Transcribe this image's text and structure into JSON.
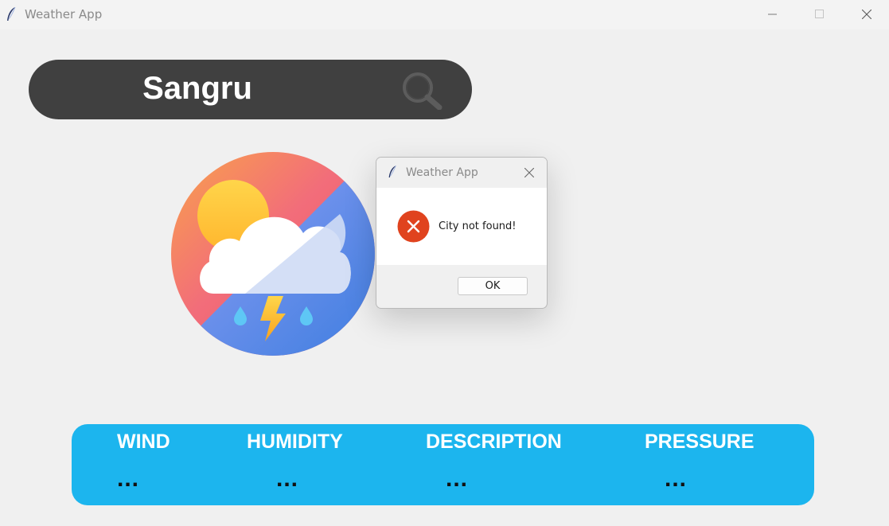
{
  "window": {
    "title": "Weather App",
    "controls": [
      "minimize-icon",
      "maximize-icon",
      "close-icon"
    ]
  },
  "search": {
    "value": "Sangru",
    "icon": "search-icon"
  },
  "weather_icon": "thunderstorm-icon",
  "dialog": {
    "title": "Weather App",
    "message": "City not found!",
    "icon": "error-icon",
    "ok_label": "OK"
  },
  "info": {
    "wind": {
      "label": "WIND",
      "value": "..."
    },
    "humidity": {
      "label": "HUMIDITY",
      "value": "..."
    },
    "description": {
      "label": "DESCRIPTION",
      "value": "..."
    },
    "pressure": {
      "label": "PRESSURE",
      "value": "..."
    }
  },
  "colors": {
    "search_bar": "#404040",
    "info_panel": "#1cb5ee",
    "error": "#e0431e"
  }
}
